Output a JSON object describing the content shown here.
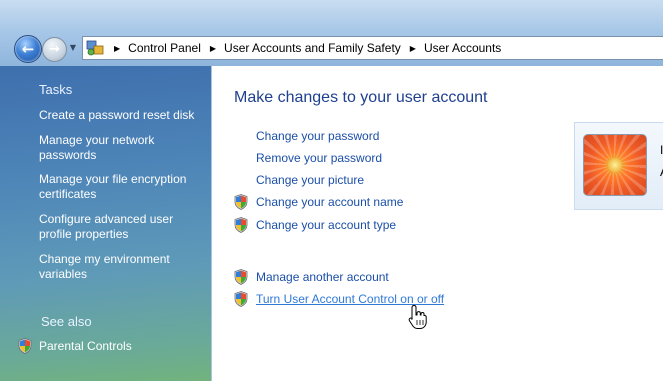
{
  "breadcrumbs": [
    "Control Panel",
    "User Accounts and Family Safety",
    "User Accounts"
  ],
  "sidebar": {
    "tasks_heading": "Tasks",
    "tasks": [
      {
        "label": "Create a password reset disk"
      },
      {
        "label": "Manage your network passwords"
      },
      {
        "label": "Manage your file encryption certificates"
      },
      {
        "label": "Configure advanced user profile properties"
      },
      {
        "label": "Change my environment variables"
      }
    ],
    "see_also_heading": "See also",
    "see_also": [
      {
        "label": "Parental Controls",
        "icon": "shield-icon"
      }
    ]
  },
  "main": {
    "title": "Make changes to your user account",
    "links": [
      {
        "label": "Change your password"
      },
      {
        "label": "Remove your password"
      },
      {
        "label": "Change your picture"
      },
      {
        "label": "Change your account name",
        "icon": "shield-icon"
      },
      {
        "label": "Change your account type",
        "icon": "shield-icon"
      }
    ],
    "other_links": [
      {
        "label": "Manage another account",
        "icon": "shield-icon"
      },
      {
        "label": "Turn User Account Control on or off",
        "icon": "shield-icon",
        "state": "hover"
      }
    ],
    "account_card": {
      "line1": "I",
      "line2": "A"
    }
  },
  "colors": {
    "link": "#1b4fa8",
    "link_hover": "#2f79d6",
    "title": "#1f3f8f",
    "sidebar_top": "#3e6fae",
    "sidebar_bottom": "#72b37d"
  }
}
